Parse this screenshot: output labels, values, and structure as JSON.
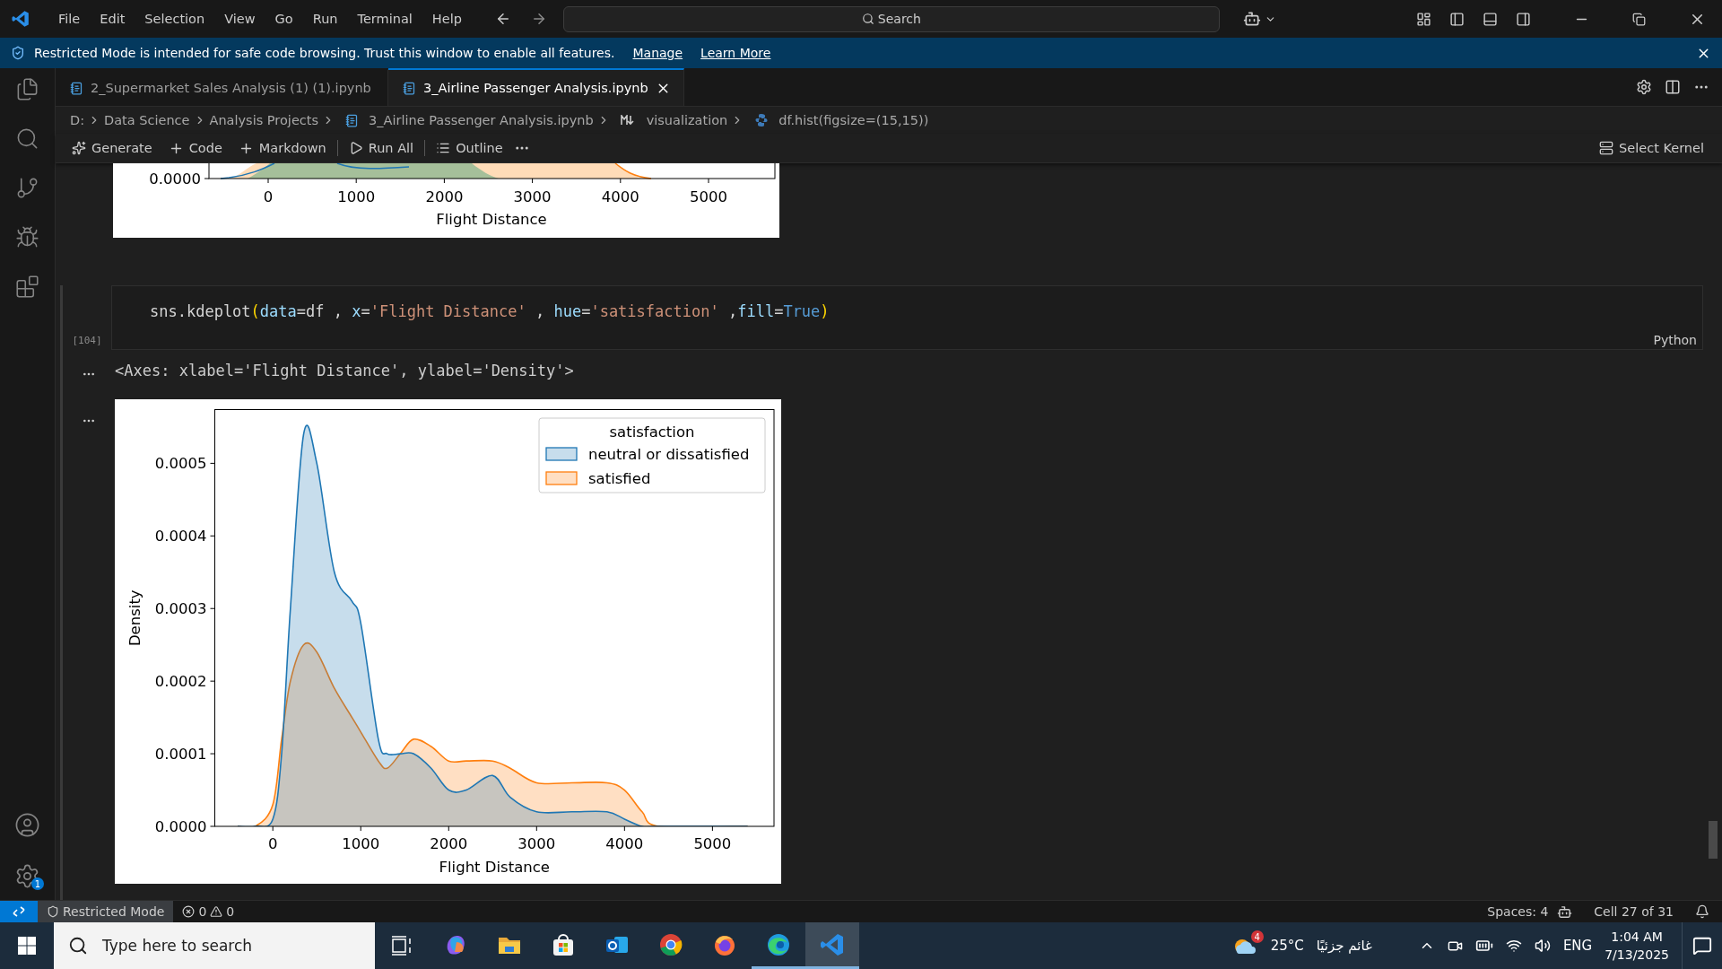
{
  "title_bar": {
    "menu": [
      "File",
      "Edit",
      "Selection",
      "View",
      "Go",
      "Run",
      "Terminal",
      "Help"
    ],
    "search": {
      "placeholder": "Search"
    }
  },
  "banner": {
    "message": "Restricted Mode is intended for safe code browsing. Trust this window to enable all features.",
    "links": [
      "Manage",
      "Learn More"
    ]
  },
  "tabs": [
    {
      "label": "2_Supermarket Sales Analysis (1) (1).ipynb",
      "selected": false
    },
    {
      "label": "3_Airline Passenger Analysis.ipynb",
      "selected": true
    }
  ],
  "breadcrumb": [
    {
      "kind": "text",
      "label": "D:"
    },
    {
      "kind": "text",
      "label": "Data Science"
    },
    {
      "kind": "text",
      "label": "Analysis Projects"
    },
    {
      "kind": "notebook",
      "label": "3_Airline Passenger Analysis.ipynb"
    },
    {
      "kind": "markdown",
      "label": "visualization"
    },
    {
      "kind": "python",
      "label": "df.hist(figsize=(15,15))"
    }
  ],
  "toolbar": {
    "actions": [
      {
        "kind": "generate",
        "label": "Generate",
        "divider_before": false
      },
      {
        "kind": "add",
        "label": "Code",
        "divider_before": false
      },
      {
        "kind": "add",
        "label": "Markdown",
        "divider_before": false
      },
      {
        "kind": "run",
        "label": "Run All",
        "divider_before": true
      },
      {
        "kind": "outline",
        "label": "Outline",
        "divider_before": true
      },
      {
        "kind": "more",
        "divider_before": false
      }
    ],
    "kernel": "Select Kernel"
  },
  "previous_plot": {
    "ytick": "0.0000",
    "xticks": [
      "0",
      "1000",
      "2000",
      "3000",
      "4000",
      "5000"
    ],
    "xlabel": "Flight Distance"
  },
  "code_cell": {
    "execution_count": "[104]",
    "language": "Python",
    "tokens": [
      {
        "kind": "plain",
        "text": "sns.kdeplot"
      },
      {
        "kind": "bracket",
        "text": "("
      },
      {
        "kind": "param",
        "text": "data"
      },
      {
        "kind": "plain",
        "text": "=df , "
      },
      {
        "kind": "param",
        "text": "x"
      },
      {
        "kind": "plain",
        "text": "="
      },
      {
        "kind": "string",
        "text": "'Flight Distance'"
      },
      {
        "kind": "plain",
        "text": " , "
      },
      {
        "kind": "param",
        "text": "hue"
      },
      {
        "kind": "plain",
        "text": "="
      },
      {
        "kind": "string",
        "text": "'satisfaction'"
      },
      {
        "kind": "plain",
        "text": " ,"
      },
      {
        "kind": "param",
        "text": "fill"
      },
      {
        "kind": "plain",
        "text": "="
      },
      {
        "kind": "keyword",
        "text": "True"
      },
      {
        "kind": "bracket",
        "text": ")"
      }
    ]
  },
  "outputs": [
    {
      "kind": "text",
      "text": "<Axes: xlabel='Flight Distance', ylabel='Density'>"
    },
    {
      "kind": "plot",
      "chart_data": {
        "type": "area",
        "xlabel": "Flight Distance",
        "ylabel": "Density",
        "legend": {
          "title": "satisfaction"
        },
        "x": [
          -400,
          -200,
          0,
          100,
          200,
          350,
          500,
          700,
          900,
          1000,
          1200,
          1300,
          1450,
          1600,
          1800,
          2000,
          2200,
          2500,
          2700,
          3000,
          3400,
          3800,
          4000,
          4200,
          4400,
          5400
        ],
        "series": [
          {
            "name": "neutral or dissatisfied",
            "color": "#1f77b4",
            "values": [
              0,
              0,
              1e-05,
              0.0001,
              0.0003,
              0.00054,
              0.0005,
              0.00035,
              0.00031,
              0.00028,
              0.00012,
              0.0001,
              0.0001,
              0.0001,
              8e-05,
              5e-05,
              5e-05,
              7e-05,
              4e-05,
              2e-05,
              2e-05,
              2e-05,
              1e-05,
              0,
              0,
              0
            ]
          },
          {
            "name": "satisfied",
            "color": "#ff7f0e",
            "values": [
              0,
              0,
              3e-05,
              0.00012,
              0.0002,
              0.00025,
              0.00024,
              0.00019,
              0.00015,
              0.00013,
              9e-05,
              8e-05,
              0.0001,
              0.00012,
              0.00011,
              9e-05,
              9e-05,
              9e-05,
              8e-05,
              6e-05,
              6e-05,
              6e-05,
              5e-05,
              2e-05,
              0,
              0
            ]
          }
        ],
        "xlim": [
          -660,
          5700
        ],
        "ylim": [
          0,
          0.000574
        ],
        "xticks": [
          0,
          1000,
          2000,
          3000,
          4000,
          5000
        ],
        "yticks": [
          {
            "value": 0,
            "label": "0.0000"
          },
          {
            "value": 0.0001,
            "label": "0.0001"
          },
          {
            "value": 0.0002,
            "label": "0.0002"
          },
          {
            "value": 0.0003,
            "label": "0.0003"
          },
          {
            "value": 0.0004,
            "label": "0.0004"
          },
          {
            "value": 0.0005,
            "label": "0.0005"
          }
        ],
        "stacked": false
      }
    }
  ],
  "activity_bar": {
    "settings_badge": "1"
  },
  "status_bar": {
    "restricted": "Restricted Mode",
    "errors": "0",
    "warnings": "0",
    "spaces": "Spaces: 4",
    "cell": "Cell 27 of 31"
  },
  "taskbar": {
    "search_placeholder": "Type here to search",
    "apps": [
      {
        "kind": "copilot",
        "running": false,
        "selected": false
      },
      {
        "kind": "files",
        "running": false,
        "selected": false
      },
      {
        "kind": "store",
        "running": false,
        "selected": false
      },
      {
        "kind": "outlook",
        "running": false,
        "selected": false
      },
      {
        "kind": "chrome",
        "running": false,
        "selected": false
      },
      {
        "kind": "firefox",
        "running": false,
        "selected": false
      },
      {
        "kind": "edge",
        "running": true,
        "selected": false
      },
      {
        "kind": "vscode",
        "running": true,
        "selected": true
      }
    ],
    "weather": {
      "temp": "25°C",
      "condition": "غائم جزئيًا",
      "badge": "4"
    },
    "language": "ENG",
    "time": "1:04 AM",
    "date": "7/13/2025"
  }
}
